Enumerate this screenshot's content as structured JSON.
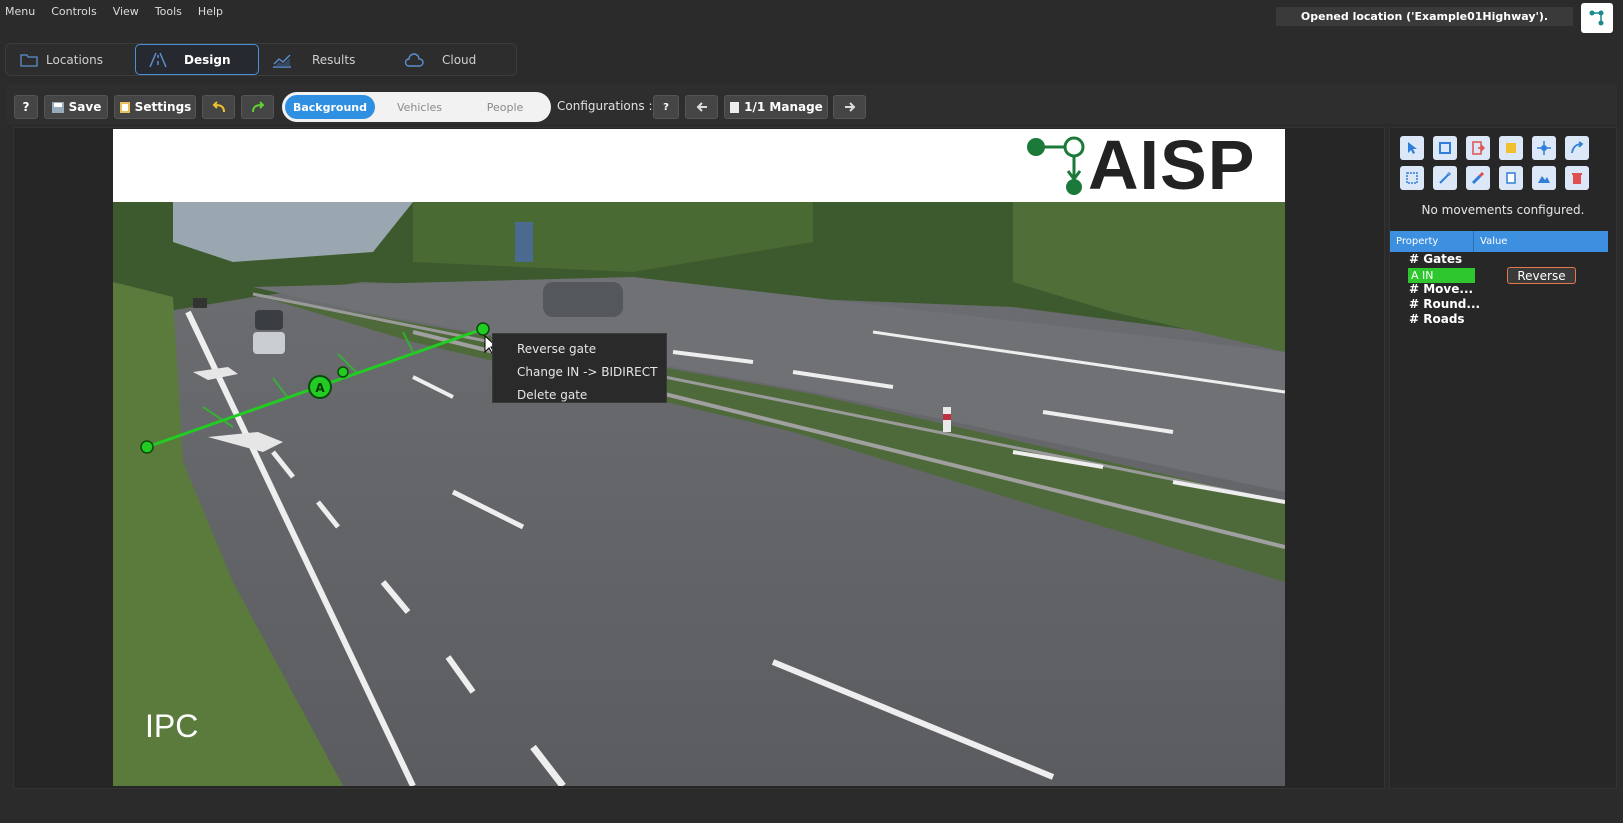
{
  "menu": [
    "Menu",
    "Controls",
    "View",
    "Tools",
    "Help"
  ],
  "status": {
    "message": "Opened location ('Example01Highway')."
  },
  "main_tabs": [
    {
      "label": "Locations",
      "icon": "folder-icon"
    },
    {
      "label": "Design",
      "icon": "road-icon",
      "active": true
    },
    {
      "label": "Results",
      "icon": "chart-icon"
    },
    {
      "label": "Cloud",
      "icon": "cloud-icon"
    }
  ],
  "toolbar": {
    "help_label": "?",
    "save_label": "Save",
    "settings_label": "Settings",
    "layers": [
      "Background",
      "Vehicles",
      "People"
    ],
    "active_layer": "Background",
    "configurations_label": "Configurations :",
    "config_help": "?",
    "manage_label": "1/1 Manage"
  },
  "video": {
    "banner_text": "AISP",
    "watermark": "IPC",
    "gate_marker": "A"
  },
  "context_menu": [
    "Reverse gate",
    "Change IN -> BIDIRECT",
    "Delete gate"
  ],
  "panel": {
    "no_movements": "No movements configured.",
    "property_header": "Property",
    "value_header": "Value",
    "tree": [
      "# Gates",
      "# Move...",
      "# Round...",
      "# Roads"
    ],
    "gate_item": "A IN",
    "reverse_label": "Reverse"
  },
  "colors": {
    "accent": "#3d8fe0",
    "gate": "#22cc22",
    "gate_chip": "#2ec72e"
  }
}
